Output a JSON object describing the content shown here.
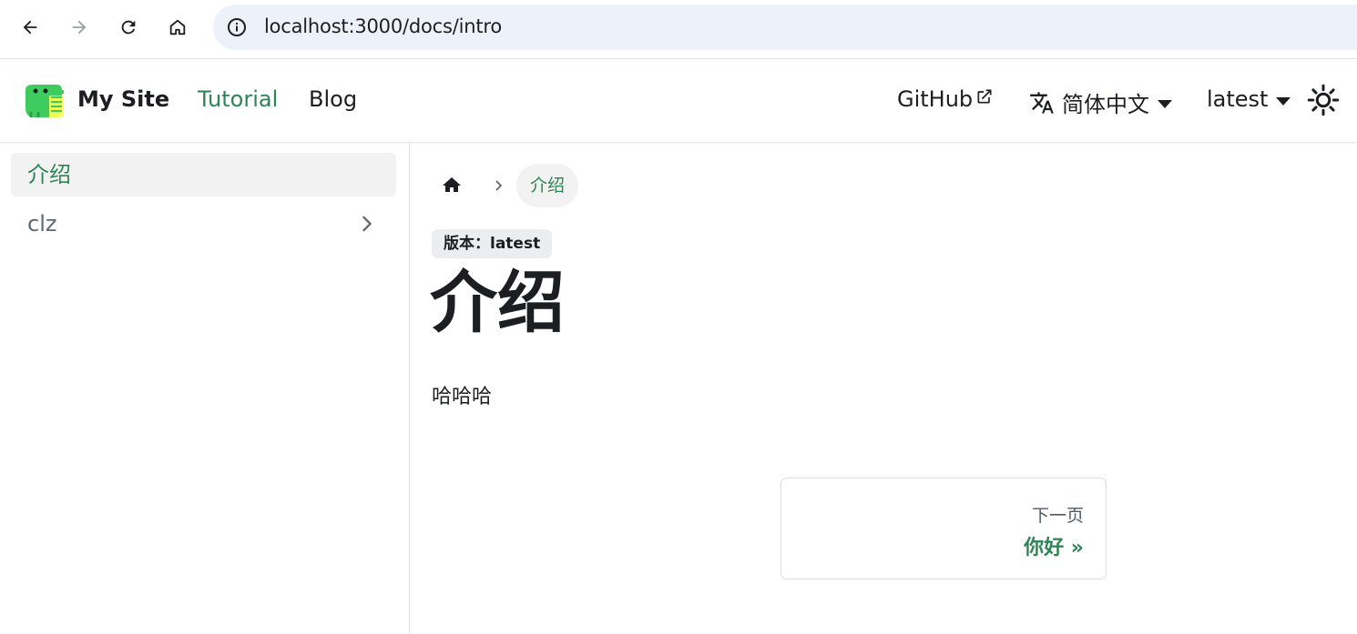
{
  "browser": {
    "url": "localhost:3000/docs/intro",
    "icons": [
      "back-icon",
      "forward-icon",
      "reload-icon",
      "home-icon",
      "info-icon"
    ]
  },
  "navbar": {
    "site_title": "My Site",
    "links": {
      "tutorial": "Tutorial",
      "blog": "Blog",
      "github": "GitHub",
      "language": "简体中文",
      "version": "latest"
    },
    "accent_color": "#2e8555"
  },
  "sidebar": {
    "items": [
      {
        "label": "介绍",
        "active": true
      },
      {
        "label": "clz",
        "active": false,
        "collapsible": true
      }
    ]
  },
  "breadcrumb": {
    "current": "介绍"
  },
  "doc": {
    "version_badge": "版本：latest",
    "title": "介绍",
    "body": "哈哈哈"
  },
  "pagination": {
    "next_sublabel": "下一页",
    "next_label": "你好 »"
  }
}
